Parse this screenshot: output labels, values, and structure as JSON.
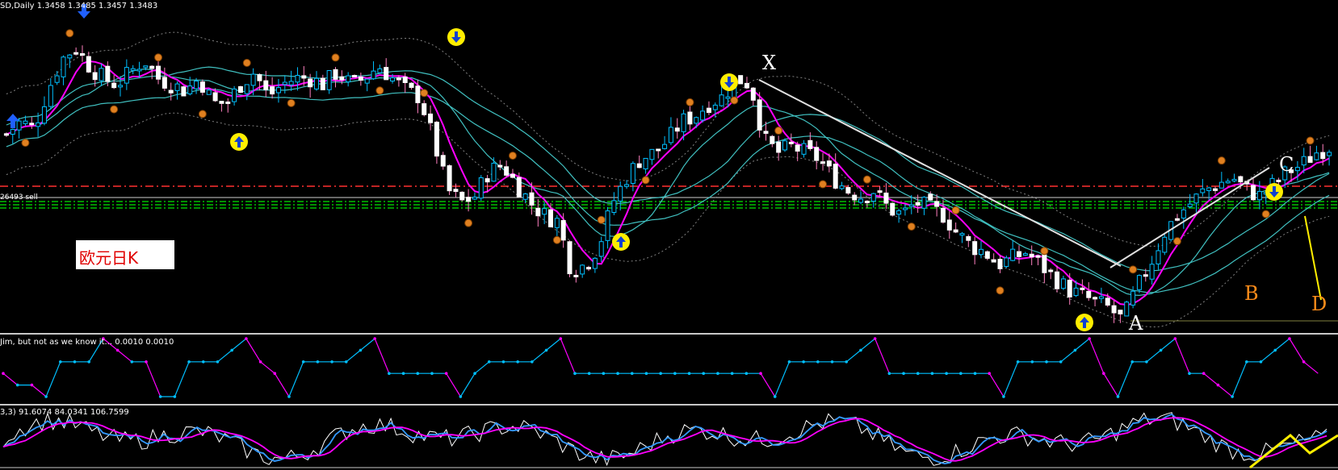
{
  "window": {
    "symbol_header": "SD,Daily  1.3458 1.3485 1.3457 1.3483",
    "sell_line_label": "26493 sell",
    "title_box_text": "欧元日K"
  },
  "pattern_labels": {
    "x": "X",
    "a": "A",
    "b": "B",
    "c": "C",
    "d": "D"
  },
  "indicator1": {
    "header": "Jim, but not as we know it...  0.0010 0.0010"
  },
  "indicator2": {
    "header": "3,3) 91.6074 84.0341 106.7599"
  },
  "colors": {
    "background": "#000000",
    "bull_candle": "#00bfff",
    "bear_candle": "#ffffff",
    "ma_fast": "#ff00ff",
    "ma_slow": "#40c0c0",
    "envelope": "#808080",
    "sell_line": "#ff3030",
    "level_lines": "#00c000",
    "indicator_up": "#00bfff",
    "indicator_down": "#ff00ff",
    "stoch_white": "#ffffff",
    "stoch_blue": "#3399ff",
    "stoch_magenta": "#ff00ff",
    "pattern_accent": "#ff8c1a",
    "pattern_yellow": "#ffee00"
  },
  "chart_data": {
    "type": "candlestick",
    "timeframe": "Daily",
    "last_bar": {
      "open": 1.3458,
      "high": 1.3485,
      "low": 1.3457,
      "close": 1.3483
    },
    "close_path_norm": [
      0.62,
      0.66,
      0.64,
      0.76,
      0.86,
      0.9,
      0.84,
      0.8,
      0.78,
      0.82,
      0.86,
      0.8,
      0.78,
      0.76,
      0.8,
      0.72,
      0.72,
      0.78,
      0.82,
      0.74,
      0.78,
      0.8,
      0.8,
      0.78,
      0.82,
      0.78,
      0.8,
      0.84,
      0.8,
      0.76,
      0.74,
      0.6,
      0.44,
      0.4,
      0.42,
      0.5,
      0.52,
      0.46,
      0.4,
      0.36,
      0.34,
      0.18,
      0.2,
      0.26,
      0.4,
      0.48,
      0.54,
      0.56,
      0.6,
      0.66,
      0.68,
      0.72,
      0.74,
      0.8,
      0.78,
      0.6,
      0.56,
      0.58,
      0.56,
      0.54,
      0.48,
      0.44,
      0.42,
      0.44,
      0.38,
      0.36,
      0.4,
      0.38,
      0.36,
      0.3,
      0.26,
      0.24,
      0.2,
      0.22,
      0.24,
      0.2,
      0.16,
      0.12,
      0.1,
      0.08,
      0.06,
      0.02,
      0.12,
      0.2,
      0.3,
      0.36,
      0.4,
      0.44,
      0.46,
      0.48,
      0.44,
      0.42,
      0.46,
      0.5,
      0.52,
      0.56,
      0.58
    ],
    "level_lines": {
      "sell_line": 0.49,
      "support_lines": [
        0.42,
        0.44,
        0.46
      ]
    },
    "indicator1_levels": [
      0,
      0.2,
      0.4,
      0.6,
      0.8,
      1
    ],
    "indicator1_states": [
      2,
      1,
      1,
      0,
      3,
      3,
      3,
      5,
      4,
      3,
      3,
      0,
      0,
      3,
      3,
      3,
      4,
      5,
      3,
      2,
      0,
      3,
      3,
      3,
      3,
      4,
      5,
      2,
      2,
      2,
      2,
      2,
      0,
      2,
      3,
      3,
      3,
      3,
      4,
      5,
      2,
      2,
      2,
      2,
      2,
      2,
      2,
      2,
      2,
      2,
      2,
      2,
      2,
      2,
      0,
      3,
      3,
      3,
      3,
      3,
      4,
      5,
      2,
      2,
      2,
      2,
      2,
      2,
      2,
      2,
      0,
      3,
      3,
      3,
      3,
      4,
      5,
      2,
      0,
      3,
      3,
      4,
      5,
      2,
      2,
      1,
      0,
      3,
      3,
      4,
      5,
      3,
      2
    ],
    "oscillator_range": [
      0,
      100
    ]
  }
}
